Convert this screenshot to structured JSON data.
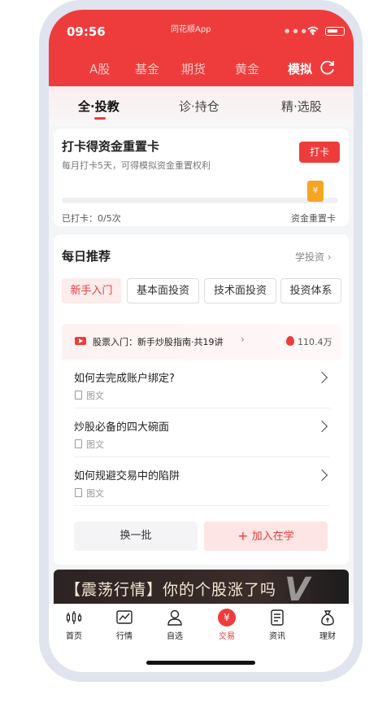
{
  "status": {
    "time": "09:56",
    "app_label": "同花顺App"
  },
  "market_tabs": [
    "A股",
    "基金",
    "期货",
    "黄金",
    "模拟"
  ],
  "category_tabs": [
    "全·投教",
    "诊·持仓",
    "精·选股"
  ],
  "checkin": {
    "title": "打卡得资金重置卡",
    "subtitle": "每月打卡5天，可得模拟资金重置权利",
    "button_label": "打卡",
    "count_text": "已打卡：0/5次",
    "reward_label": "资金重置卡",
    "progress": 0
  },
  "daily": {
    "title": "每日推荐",
    "link_label": "学投资",
    "chips": [
      "新手入门",
      "基本面投资",
      "技术面投资",
      "投资体系"
    ],
    "course": {
      "title": "股票入门：新手炒股指南·共19讲",
      "views": "110.4万"
    },
    "articles": [
      {
        "title": "如何去完成账户绑定?",
        "type": "图文"
      },
      {
        "title": "炒股必备的四大碗面",
        "type": "图文"
      },
      {
        "title": "如何规避交易中的陷阱",
        "type": "图文"
      }
    ],
    "refresh_label": "换一批",
    "join_label": "加入在学"
  },
  "banner": {
    "text": "【震荡行情】你的个股涨了吗",
    "deco": "V"
  },
  "bottom_nav": [
    "首页",
    "行情",
    "自选",
    "交易",
    "资讯",
    "理财"
  ],
  "trade_symbol": "¥",
  "colors": {
    "accent": "#ee3c3c",
    "reward": "#f5a524"
  }
}
